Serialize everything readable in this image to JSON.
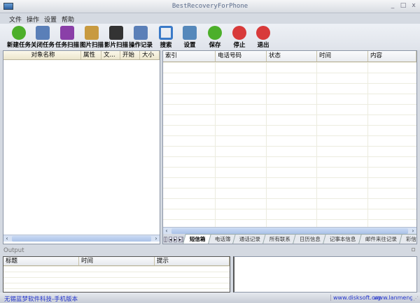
{
  "window": {
    "title": "BestRecoveryForPhone",
    "minimize": "_",
    "maximize": "□",
    "close": "x"
  },
  "menu": [
    "文件",
    "操作",
    "设置",
    "帮助"
  ],
  "toolbar": [
    {
      "label": "新建任务",
      "icon": "new-task-icon",
      "color": "#4caf2a"
    },
    {
      "label": "关闭任务",
      "icon": "calendar-icon",
      "color": "#5a7fb8"
    },
    {
      "label": "任务扫描",
      "icon": "books-icon",
      "color": "#8a3fa8"
    },
    {
      "label": "图片扫描",
      "icon": "picture-icon",
      "color": "#c89a40"
    },
    {
      "label": "影片扫描",
      "icon": "film-icon",
      "color": "#333333"
    },
    {
      "label": "操作记录",
      "icon": "calendar-icon",
      "color": "#5a7fb8"
    },
    {
      "label": "搜索",
      "icon": "search-icon",
      "color": "#3a7ac8"
    },
    {
      "label": "设置",
      "icon": "tools-icon",
      "color": "#5588bb"
    },
    {
      "label": "保存",
      "icon": "check-icon",
      "color": "#4caf2a"
    },
    {
      "label": "停止",
      "icon": "stop-icon",
      "color": "#d83a3a"
    },
    {
      "label": "退出",
      "icon": "exit-icon",
      "color": "#d83a3a"
    }
  ],
  "left_table": {
    "columns": [
      "对象名称",
      "属性",
      "文...",
      "开始",
      "大小"
    ]
  },
  "right_table": {
    "columns": [
      "索引",
      "电话号码",
      "状态",
      "时间",
      "内容"
    ]
  },
  "tabs": [
    "短信箱",
    "电话簿",
    "通话记录",
    "所有联系",
    "日历信息",
    "记事本信息",
    "邮件来往记录",
    "彩信通讯"
  ],
  "output": {
    "label": "Output",
    "columns": [
      "标题",
      "时间",
      "提示"
    ]
  },
  "status": {
    "left": "无锡蓝梦软件科技-手机版本",
    "link1": "www.disksoft.org",
    "link2": "www.lanmengsoft"
  }
}
